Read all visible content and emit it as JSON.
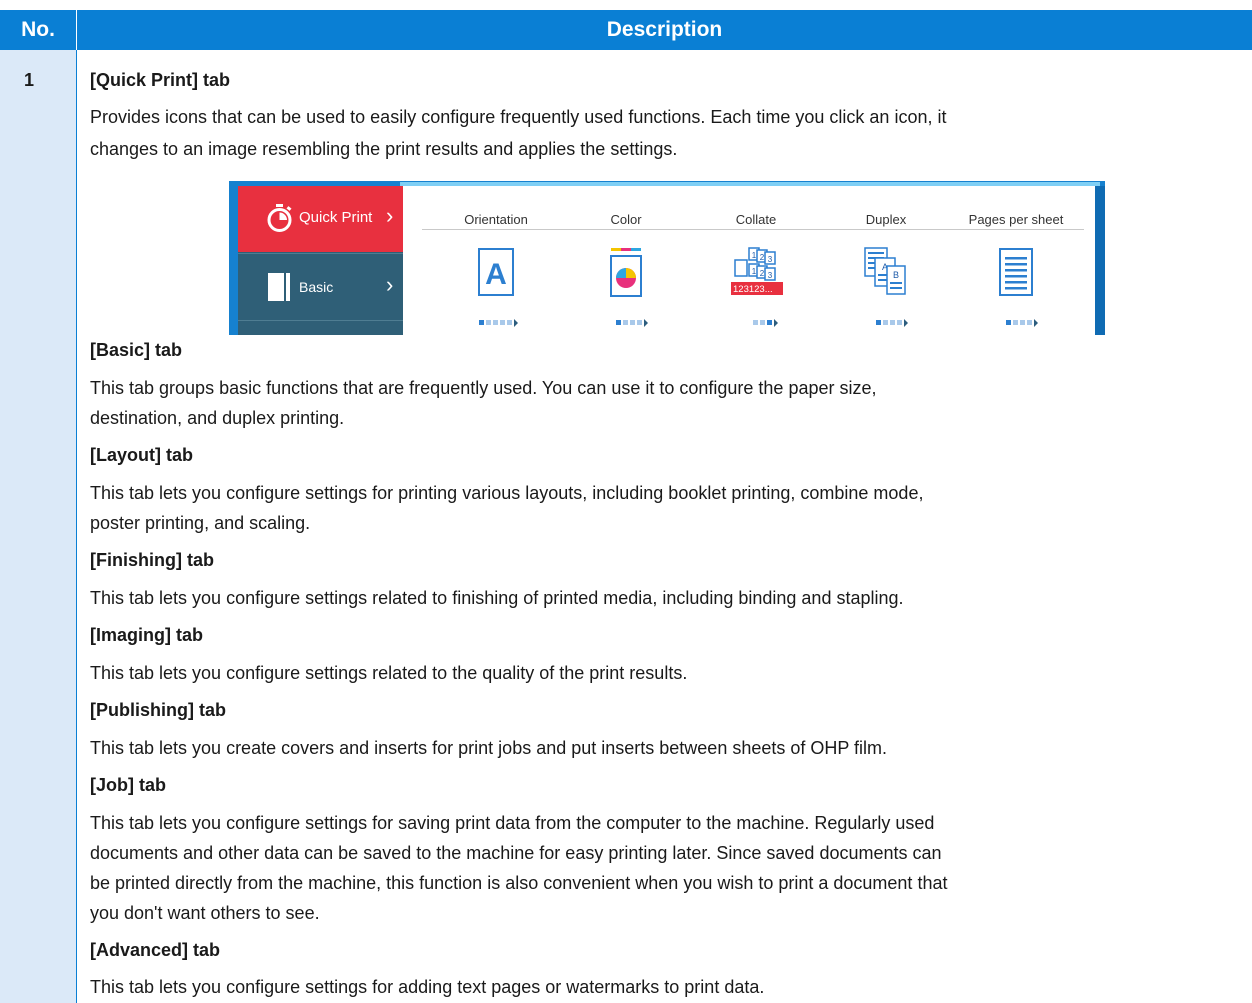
{
  "header": {
    "col_no": "No.",
    "col_description": "Description"
  },
  "row": {
    "number": "1"
  },
  "quick_print": {
    "heading": "[Quick Print] tab",
    "text_line1": "Provides icons that can be used to easily configure frequently used functions. Each time you click an icon, it",
    "text_line2": "changes to an image resembling the print results and applies the settings."
  },
  "screenshot": {
    "sidebar": [
      {
        "label": "Quick Print",
        "icon": "stopwatch-icon",
        "active": true
      },
      {
        "label": "Basic",
        "icon": "page-icon",
        "active": false
      }
    ],
    "options": [
      {
        "label": "Orientation",
        "icon": "portrait-letter-a-icon"
      },
      {
        "label": "Color",
        "icon": "color-page-icon"
      },
      {
        "label": "Collate",
        "icon": "collate-stack-icon",
        "icon_text": "123123..."
      },
      {
        "label": "Duplex",
        "icon": "duplex-pages-icon"
      },
      {
        "label": "Pages per sheet",
        "icon": "single-page-icon"
      }
    ],
    "colors": {
      "active_tab": "#e8303f",
      "sidebar": "#2f5f77",
      "frame": "#1681cf"
    }
  },
  "sections": [
    {
      "heading": "[Basic] tab",
      "lines": [
        "This tab groups basic functions that are frequently used. You can use it to configure the paper size,",
        "destination, and duplex printing."
      ]
    },
    {
      "heading": "[Layout] tab",
      "lines": [
        "This tab lets you configure settings for printing various layouts, including booklet printing, combine mode,",
        "poster printing, and scaling."
      ]
    },
    {
      "heading": "[Finishing] tab",
      "lines": [
        "This tab lets you configure settings related to finishing of printed media, including binding and stapling."
      ]
    },
    {
      "heading": "[Imaging] tab",
      "lines": [
        "This tab lets you configure settings related to the quality of the print results."
      ]
    },
    {
      "heading": "[Publishing] tab",
      "lines": [
        "This tab lets you create covers and inserts for print jobs and put inserts between sheets of OHP film."
      ]
    },
    {
      "heading": "[Job] tab",
      "lines": [
        "This tab lets you configure settings for saving print data from the computer to the machine. Regularly used",
        "documents and other data can be saved to the machine for easy printing later. Since saved documents can",
        "be printed directly from the machine, this function is also convenient when you wish to print a document that",
        "you don't want others to see."
      ]
    },
    {
      "heading": "[Advanced] tab",
      "lines": [
        "This tab lets you configure settings for adding text pages or watermarks to print data."
      ]
    }
  ],
  "colors": {
    "header_bg": "#0a7fd4",
    "number_col_bg": "#dbe9f8"
  }
}
